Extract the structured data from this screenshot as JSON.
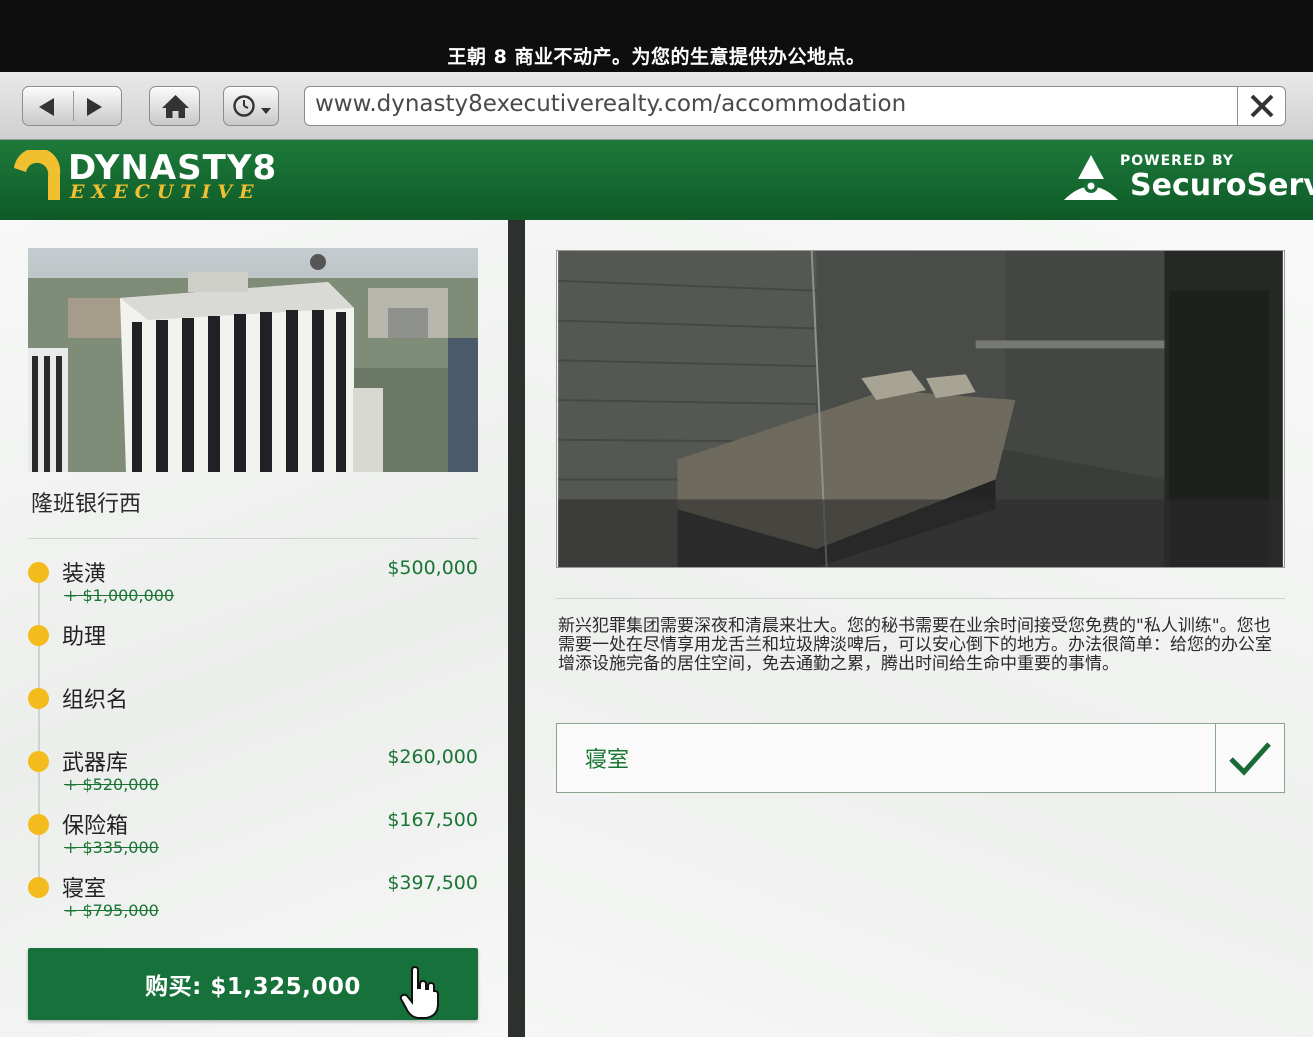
{
  "banner": {
    "text": "王朝 8 商业不动产。为您的生意提供办公地点。"
  },
  "browser": {
    "url": "www.dynasty8executiverealty.com/accommodation",
    "icons": [
      "back-arrow-icon",
      "forward-arrow-icon",
      "home-icon",
      "history-clock-icon",
      "close-icon"
    ]
  },
  "header": {
    "brand_name": "DYNASTY8",
    "brand_sub": "EXECUTIVE",
    "powered_by": "POWERED BY",
    "partner": "SecuroServ"
  },
  "property": {
    "name": "隆班银行西",
    "items": [
      {
        "label": "装潢",
        "price": "$500,000",
        "old_price": "+ $1,000,000"
      },
      {
        "label": "助理",
        "price": "",
        "old_price": ""
      },
      {
        "label": "组织名",
        "price": "",
        "old_price": ""
      },
      {
        "label": "武器库",
        "price": "$260,000",
        "old_price": "+ $520,000"
      },
      {
        "label": "保险箱",
        "price": "$167,500",
        "old_price": "+ $335,000"
      },
      {
        "label": "寝室",
        "price": "$397,500",
        "old_price": "+ $795,000"
      }
    ],
    "buy_label": "购买: $1,325,000"
  },
  "detail": {
    "description": "新兴犯罪集团需要深夜和清晨来壮大。您的秘书需要在业余时间接受您免费的\"私人训练\"。您也需要一处在尽情享用龙舌兰和垃圾牌淡啤后，可以安心倒下的地方。办法很简单：给您的办公室增添设施完备的居住空间，免去通勤之累，腾出时间给生命中重要的事情。",
    "option_label": "寝室"
  },
  "colors": {
    "brand_green": "#17713a",
    "accent_gold": "#f3bb1c",
    "price_green": "#1a7535"
  }
}
